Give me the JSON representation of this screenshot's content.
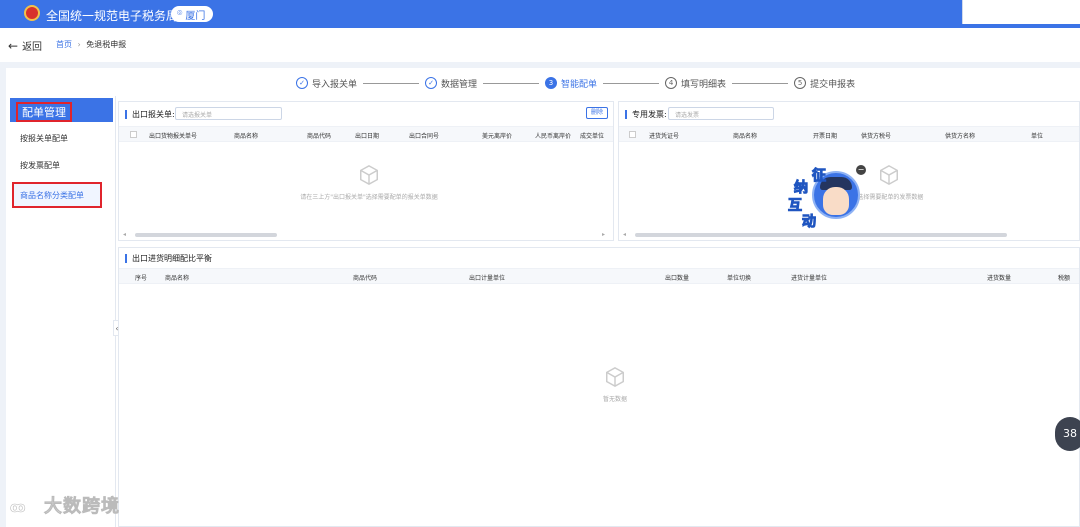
{
  "header": {
    "app_title": "全国统一规范电子税务局",
    "city": "厦门"
  },
  "nav": {
    "back_label": "返回",
    "breadcrumb_home": "首页",
    "breadcrumb_sep": "›",
    "breadcrumb_current": "免退税申报"
  },
  "steps": [
    {
      "num": "✓",
      "label": "导入报关单",
      "state": "done"
    },
    {
      "num": "✓",
      "label": "数据管理",
      "state": "done"
    },
    {
      "num": "3",
      "label": "智能配单",
      "state": "active"
    },
    {
      "num": "4",
      "label": "填写明细表",
      "state": "todo"
    },
    {
      "num": "5",
      "label": "提交申报表",
      "state": "todo"
    }
  ],
  "sidebar": {
    "title": "配单管理",
    "items": [
      {
        "label": "按报关单配单"
      },
      {
        "label": "按发票配单"
      },
      {
        "label": "商品名称分类配单"
      }
    ]
  },
  "customs_panel": {
    "title": "出口报关单:",
    "search_placeholder": "请选报关单",
    "delete_label": "删除",
    "columns": [
      "出口货物报关单号",
      "商品名称",
      "商品代码",
      "出口日期",
      "出口合同号",
      "美元离岸价",
      "人民币离岸价",
      "成交单位"
    ],
    "empty_text": "请在三上方\"出口报关单\"选择需要配单的报关单数据"
  },
  "invoice_panel": {
    "title": "专用发票:",
    "search_placeholder": "请选发票",
    "columns": [
      "进货凭证号",
      "商品名称",
      "开票日期",
      "供货方税号",
      "供货方名称",
      "单位"
    ],
    "empty_text": "\"选择需要配单的发票数据"
  },
  "detail_panel": {
    "title": "出口进货明细配比平衡",
    "columns": [
      "序号",
      "商品名称",
      "商品代码",
      "出口计量单位",
      "出口数量",
      "单位切换",
      "进货计量单位",
      "进货数量",
      "税额"
    ],
    "empty_text": "暂无数据"
  },
  "mascot": {
    "chars": [
      "征",
      "纳",
      "互",
      "动"
    ],
    "close_icon": "close-icon"
  },
  "float_button": "38",
  "watermark": "大数跨境",
  "colors": {
    "primary": "#3b73e6",
    "highlight_border": "#e0242c"
  }
}
